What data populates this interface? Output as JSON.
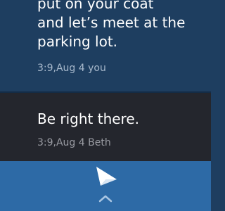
{
  "conversation": {
    "messages": [
      {
        "text": "put on your coat\nand let’s meet at the\nparking lot.",
        "timestamp": "3:9,Aug 4",
        "sender": "you"
      },
      {
        "text": "Be right there.",
        "timestamp": "3:9,Aug 4",
        "sender": "Beth"
      }
    ]
  },
  "compose": {
    "send_icon": "send-icon",
    "expand_icon": "chevron-up-icon"
  },
  "colors": {
    "sent_background": "#1e3e60",
    "received_background": "#24262d",
    "compose_background": "#2d6aa6",
    "meta_text": "#a7b8cb"
  }
}
